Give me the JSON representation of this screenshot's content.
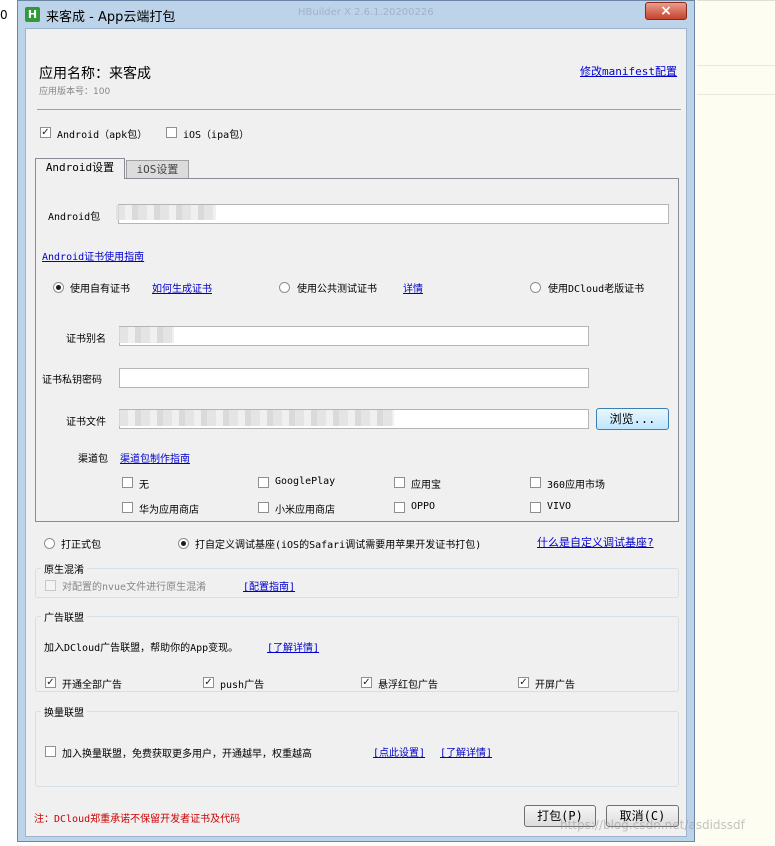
{
  "window": {
    "title": "来客成 - App云端打包",
    "close": "×"
  },
  "background": {
    "left_char": "0",
    "faded_title": "HBuilder X 2.6.1.20200226"
  },
  "header": {
    "app_name_label": "应用名称：来客成",
    "version_label": "应用版本号：100",
    "manifest_link": "修改manifest配置"
  },
  "platforms": {
    "android": "Android（apk包）",
    "ios": "iOS（ipa包）"
  },
  "tabs": [
    {
      "label": "Android设置"
    },
    {
      "label": "iOS设置"
    }
  ],
  "android": {
    "package_label": "Android包",
    "cert_guide_link": "Android证书使用指南",
    "cert_options": {
      "own": "使用自有证书",
      "own_link": "如何生成证书",
      "public": "使用公共测试证书",
      "public_link": "详情",
      "old": "使用DCloud老版证书"
    },
    "alias_label": "证书别名",
    "password_label": "证书私钥密码",
    "file_label": "证书文件",
    "browse_button": "浏览...",
    "channel_label": "渠道包",
    "channel_link": "渠道包制作指南",
    "channels": [
      "无",
      "GooglePlay",
      "应用宝",
      "360应用市场",
      "华为应用商店",
      "小米应用商店",
      "OPPO",
      "VIVO"
    ]
  },
  "build_mode": {
    "formal": "打正式包",
    "custom": "打自定义调试基座(iOS的Safari调试需要用苹果开发证书打包)",
    "custom_link": "什么是自定义调试基座?"
  },
  "obfuscation": {
    "title": "原生混淆",
    "checkbox": "对配置的nvue文件进行原生混淆",
    "link": "[配置指南]"
  },
  "ads": {
    "title": "广告联盟",
    "desc": "加入DCloud广告联盟，帮助你的App变现。",
    "link": "[了解详情]",
    "options": [
      "开通全部广告",
      "push广告",
      "悬浮红包广告",
      "开屏广告"
    ]
  },
  "exchange": {
    "title": "换量联盟",
    "checkbox": "加入换量联盟，免费获取更多用户，开通越早，权重越高",
    "link_settings": "[点此设置]",
    "link_details": "[了解详情]"
  },
  "footer": {
    "note": "注：DCloud郑重承诺不保留开发者证书及代码",
    "build_button": "打包(P)",
    "cancel_button": "取消(C)",
    "watermark": "https://blog.csdn.net/asdidssdf"
  },
  "colors": {
    "note": "#cc0000",
    "link": "#0000cc",
    "close": "#c7432b"
  }
}
